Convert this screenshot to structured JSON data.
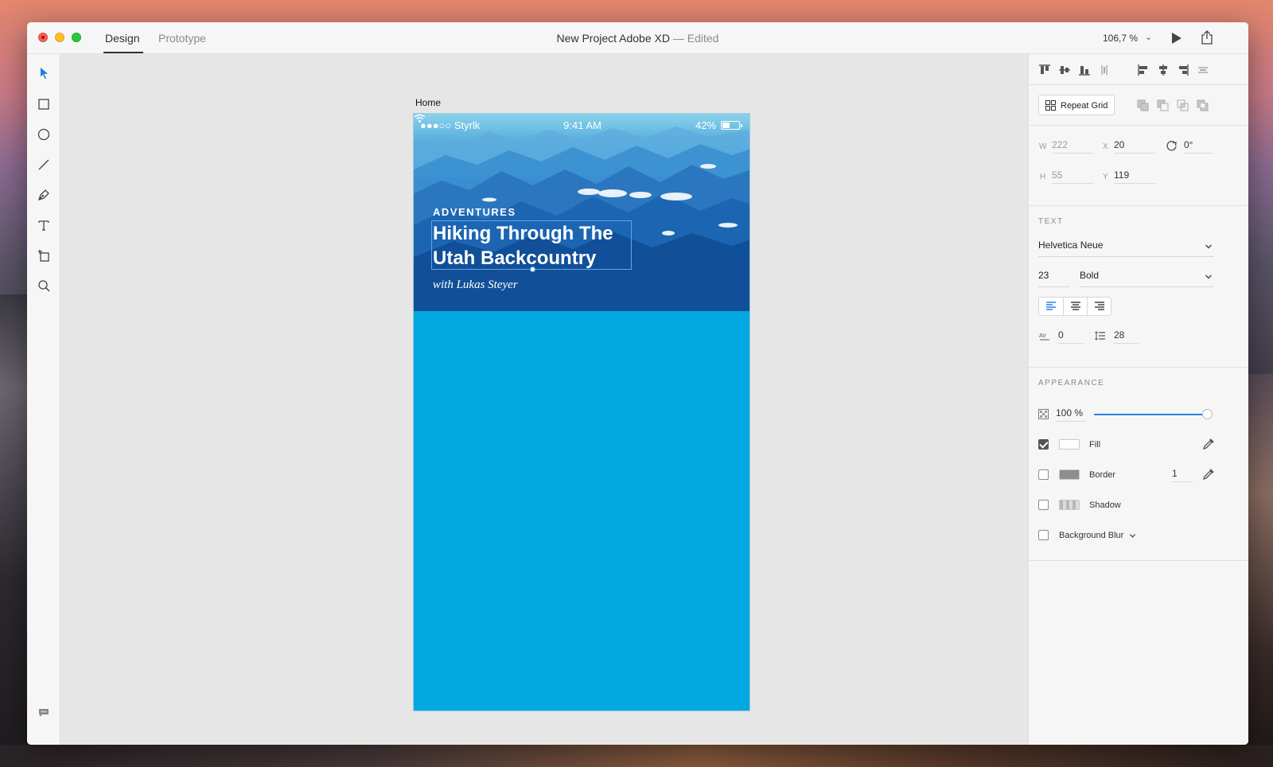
{
  "window": {
    "tabs": [
      {
        "label": "Design",
        "active": true
      },
      {
        "label": "Prototype",
        "active": false
      }
    ],
    "title": "New Project Adobe XD",
    "title_sep": " — ",
    "title_status": "Edited",
    "zoom": "106,7 %",
    "zoom_chevron": "⌄"
  },
  "tools": [
    "select-arrow-icon",
    "rectangle-icon",
    "ellipse-icon",
    "line-icon",
    "pen-icon",
    "text-icon",
    "artboard-icon",
    "zoom-icon"
  ],
  "artboard": {
    "name": "Home",
    "status_bar": {
      "carrier": "●●●○○ Styrlk",
      "time": "9:41 AM",
      "battery": "42%"
    },
    "hero": {
      "kicker": "ADVENTURES",
      "title_line1": "Hiking  Through The",
      "title_line2": "Utah Backcountry",
      "byline": "with Lukas Steyer"
    },
    "background_color": "#02a8e0"
  },
  "inspector": {
    "repeat_grid": "Repeat Grid",
    "transform": {
      "w_label": "W",
      "w": "222",
      "x_label": "X",
      "x": "20",
      "rotation": "0°",
      "h_label": "H",
      "h": "55",
      "y_label": "Y",
      "y": "119"
    },
    "text": {
      "section_title": "TEXT",
      "font_family": "Helvetica Neue",
      "font_size": "23",
      "font_weight": "Bold",
      "char_spacing": "0",
      "line_spacing": "28"
    },
    "appearance": {
      "section_title": "APPEARANCE",
      "opacity": "100 %",
      "opacity_level": 1.0,
      "fill_label": "Fill",
      "fill_checked": true,
      "fill_color": "#ffffff",
      "border_label": "Border",
      "border_checked": false,
      "border_color": "#8e8e8e",
      "border_width": "1",
      "shadow_label": "Shadow",
      "shadow_checked": false,
      "blur_label": "Background Blur",
      "blur_checked": false,
      "blur_chevron": "⌄"
    }
  },
  "accent_color": "#2a82e4"
}
